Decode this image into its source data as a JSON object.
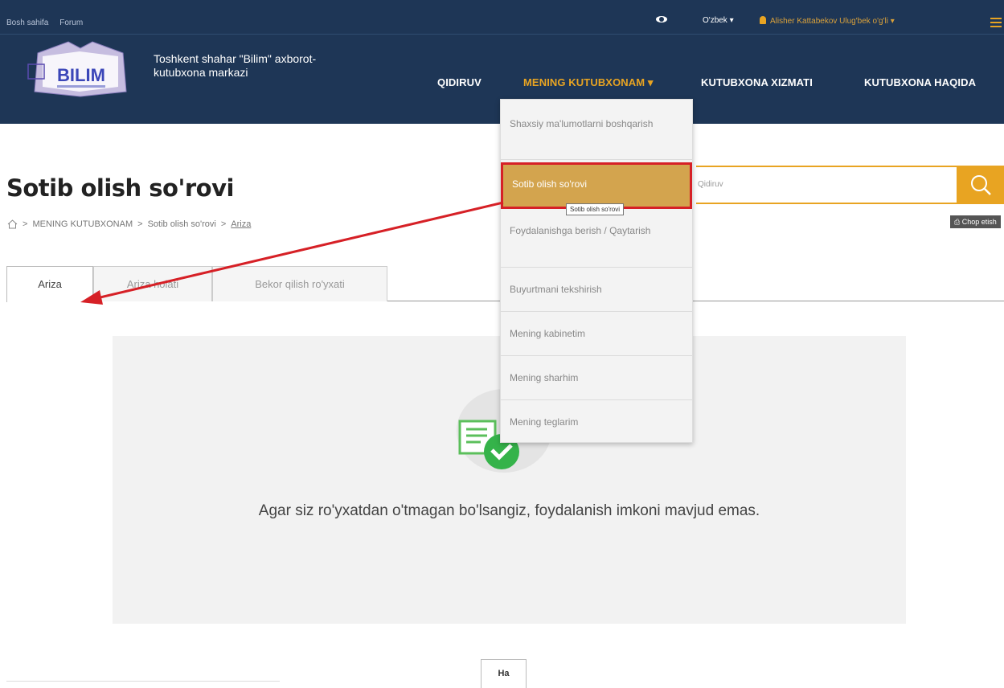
{
  "topbar": {
    "home_link": "Bosh sahifa",
    "forum_link": "Forum",
    "language": "O'zbek ▾",
    "user": "Alisher Kattabekov Ulug'bek o'g'li  ▾"
  },
  "header": {
    "logo_text": "BILIM",
    "site_title": "Toshkent shahar \"Bilim\" axborot-kutubxona markazi",
    "nav": [
      "QIDIRUV",
      "MENING KUTUBXONAM ▾",
      "KUTUBXONA XIZMATI",
      "KUTUBXONA HAQIDA"
    ]
  },
  "page": {
    "title": "Sotib olish so'rovi",
    "breadcrumb": [
      "MENING KUTUBXONAM",
      "Sotib olish so'rovi",
      "Ariza"
    ]
  },
  "search": {
    "placeholder": "Qidiruv"
  },
  "print_label": "Chop etish",
  "tabs": [
    "Ariza",
    "Ariza holati",
    "Bekor qilish ro'yxati"
  ],
  "info": {
    "message": "Agar siz ro'yxatdan o'tmagan bo'lsangiz, foydalanish imkoni mavjud emas."
  },
  "confirm_button": "Ha",
  "dropdown": {
    "items": [
      "Shaxsiy ma'lumotlarni boshqarish",
      "Sotib olish so'rovi",
      "Foydalanishga berish / Qaytarish",
      "Buyurtmani tekshirish",
      "Mening kabinetim",
      "Mening sharhim",
      "Mening teglarim"
    ],
    "tooltip": "Sotib olish so'rovi"
  },
  "colors": {
    "navy": "#1e3656",
    "accent": "#e8a422",
    "highlight_border": "#d62026"
  }
}
